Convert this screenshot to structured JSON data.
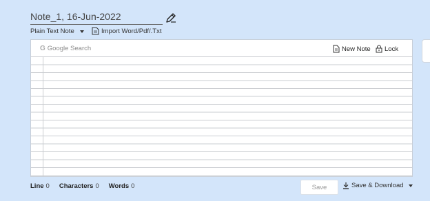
{
  "note": {
    "title": "Note_1, 16-Jun-2022"
  },
  "toolbar": {
    "type_label": "Plain Text Note",
    "import_label": "Import Word/Pdf/.Txt"
  },
  "editor": {
    "search_label": "Google Search",
    "new_note_label": "New Note",
    "lock_label": "Lock"
  },
  "stats": {
    "line_label": "Line",
    "line_value": "0",
    "characters_label": "Characters",
    "characters_value": "0",
    "words_label": "Words",
    "words_value": "0"
  },
  "footer": {
    "save_label": "Save",
    "save_download_label": "Save & Download"
  },
  "icons": [
    "pencil-icon",
    "import-doc-icon",
    "google-icon",
    "new-note-icon",
    "lock-icon",
    "download-icon",
    "chevron-down-icon"
  ]
}
